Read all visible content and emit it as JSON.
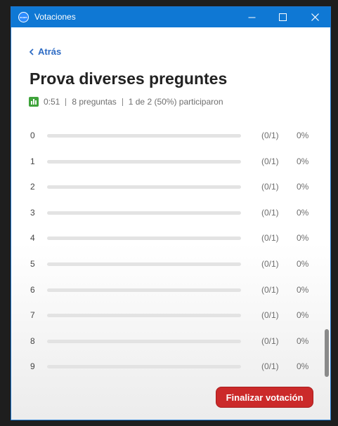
{
  "window": {
    "title": "Votaciones",
    "app_icon": "zoom-icon",
    "app_icon_text": "zoom",
    "controls": [
      "minimize-icon",
      "maximize-icon",
      "close-icon"
    ]
  },
  "nav": {
    "back_label": "Atrás",
    "back_icon": "chevron-left-icon"
  },
  "poll": {
    "title": "Prova diverses preguntes",
    "status_icon": "poll-chart-icon",
    "elapsed": "0:51",
    "questions": "8 preguntas",
    "participation": "1 de 2 (50%) participaron"
  },
  "options": [
    {
      "label": "0",
      "count": "(0/1)",
      "percent": "0%",
      "fraction": 0
    },
    {
      "label": "1",
      "count": "(0/1)",
      "percent": "0%",
      "fraction": 0
    },
    {
      "label": "2",
      "count": "(0/1)",
      "percent": "0%",
      "fraction": 0
    },
    {
      "label": "3",
      "count": "(0/1)",
      "percent": "0%",
      "fraction": 0
    },
    {
      "label": "4",
      "count": "(0/1)",
      "percent": "0%",
      "fraction": 0
    },
    {
      "label": "5",
      "count": "(0/1)",
      "percent": "0%",
      "fraction": 0
    },
    {
      "label": "6",
      "count": "(0/1)",
      "percent": "0%",
      "fraction": 0
    },
    {
      "label": "7",
      "count": "(0/1)",
      "percent": "0%",
      "fraction": 0
    },
    {
      "label": "8",
      "count": "(0/1)",
      "percent": "0%",
      "fraction": 0
    },
    {
      "label": "9",
      "count": "(0/1)",
      "percent": "0%",
      "fraction": 0
    }
  ],
  "footer": {
    "end_poll_label": "Finalizar votación"
  },
  "colors": {
    "titlebar": "#0f78d4",
    "link": "#2d6bc4",
    "poll_icon": "#3fa33b",
    "end_button": "#cb2a2a",
    "bar_track": "#e3e3e3"
  }
}
